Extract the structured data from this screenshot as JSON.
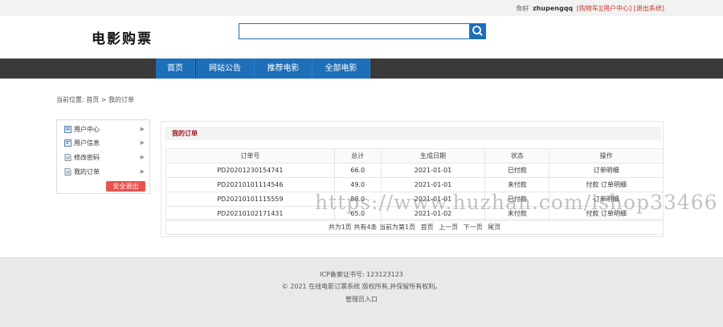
{
  "topbar": {
    "greeting": "你好",
    "username": "zhupengqq",
    "links": [
      "[购物车]",
      "[用户中心]",
      "[退出系统]"
    ]
  },
  "header": {
    "logo_text": "电影购票",
    "search_placeholder": "",
    "search_icon": "search-icon"
  },
  "nav": {
    "items": [
      "首页",
      "网站公告",
      "推荐电影",
      "全部电影"
    ]
  },
  "breadcrumb": {
    "prefix": "当前位置:",
    "home": "首页",
    "separator": ">",
    "current": "我的订单"
  },
  "sidebar": {
    "items": [
      {
        "label": "用户中心",
        "icon": "user-center-icon"
      },
      {
        "label": "用户信息",
        "icon": "user-info-icon"
      },
      {
        "label": "修改密码",
        "icon": "password-icon"
      },
      {
        "label": "我的订单",
        "icon": "orders-icon"
      }
    ],
    "logout_label": "安全退出"
  },
  "orders": {
    "title": "我的订单",
    "columns": [
      "订单号",
      "总计",
      "生成日期",
      "状态",
      "操作"
    ],
    "rows": [
      {
        "id": "PD20201230154741",
        "total": "66.0",
        "date": "2021-01-01",
        "status": "已付款",
        "action": "订单明细"
      },
      {
        "id": "PD20210101114546",
        "total": "49.0",
        "date": "2021-01-01",
        "status": "未付款",
        "action": "付款 订单明细"
      },
      {
        "id": "PD20210101115559",
        "total": "88.0",
        "date": "2021-01-01",
        "status": "已付款",
        "action": "订单明细"
      },
      {
        "id": "PD20210102171431",
        "total": "65.0",
        "date": "2021-01-02",
        "status": "未付款",
        "action": "付款 订单明细"
      }
    ],
    "pager": {
      "summary": "共为1页 共有4条 当前为第1页",
      "first": "首页",
      "prev": "上一页",
      "next": "下一页",
      "last": "尾页"
    }
  },
  "footer": {
    "icp": "ICP备案证书号: 123123123",
    "copyright": "© 2021 在线电影订票系统 版权所有,并保留所有权利。",
    "admin_link": "管理员入口"
  },
  "watermark": "https://www.huzhan.com/ishop33466",
  "colors": {
    "accent": "#1d6fb8",
    "nav_bg": "#3a3a3a",
    "title_red": "#a3111a",
    "logout_btn": "#e8534f"
  }
}
